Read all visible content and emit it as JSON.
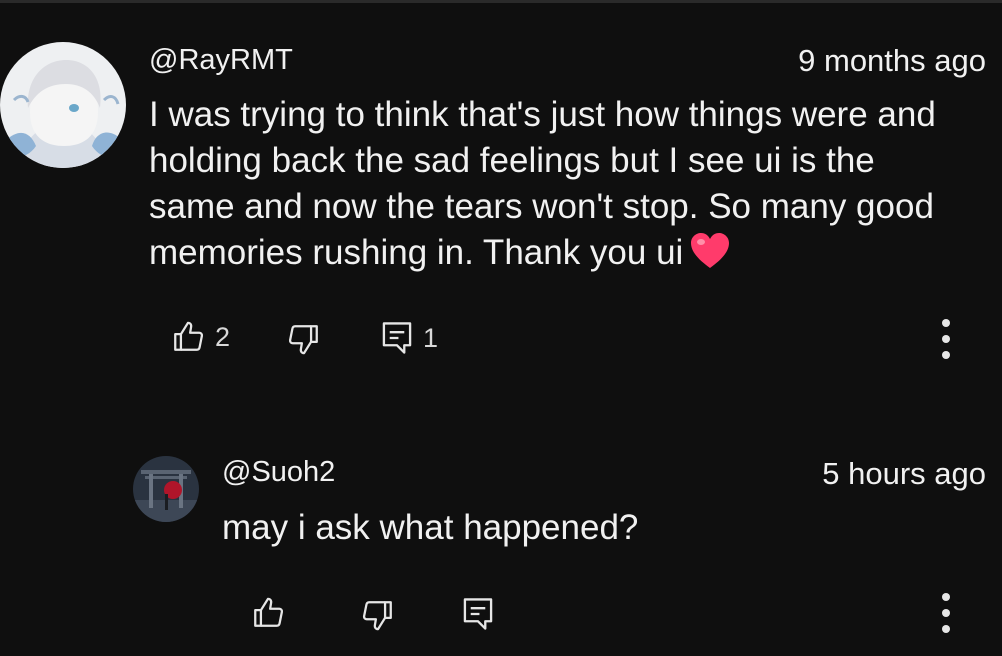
{
  "comment": {
    "author": "@RayRMT",
    "timestamp": "9 months ago",
    "lines": [
      "I was trying to think that's just how things were and",
      "holding back the sad feelings but I see ui is the",
      "same and now the tears won't stop. So many good",
      "memories rushing in. Thank you ui"
    ],
    "emoji": "heart",
    "like_count": "2",
    "reply_count": "1",
    "icons": [
      "like-icon",
      "dislike-icon",
      "reply-icon",
      "more-vert-icon"
    ]
  },
  "reply": {
    "author": "@Suoh2",
    "timestamp": "5 hours ago",
    "text": "may i ask what happened?",
    "icons": [
      "like-icon",
      "dislike-icon",
      "reply-icon",
      "more-vert-icon"
    ]
  },
  "colors": {
    "background": "#0f0f0f",
    "text": "#f1f1f1",
    "heart": "#ff3b6b"
  }
}
